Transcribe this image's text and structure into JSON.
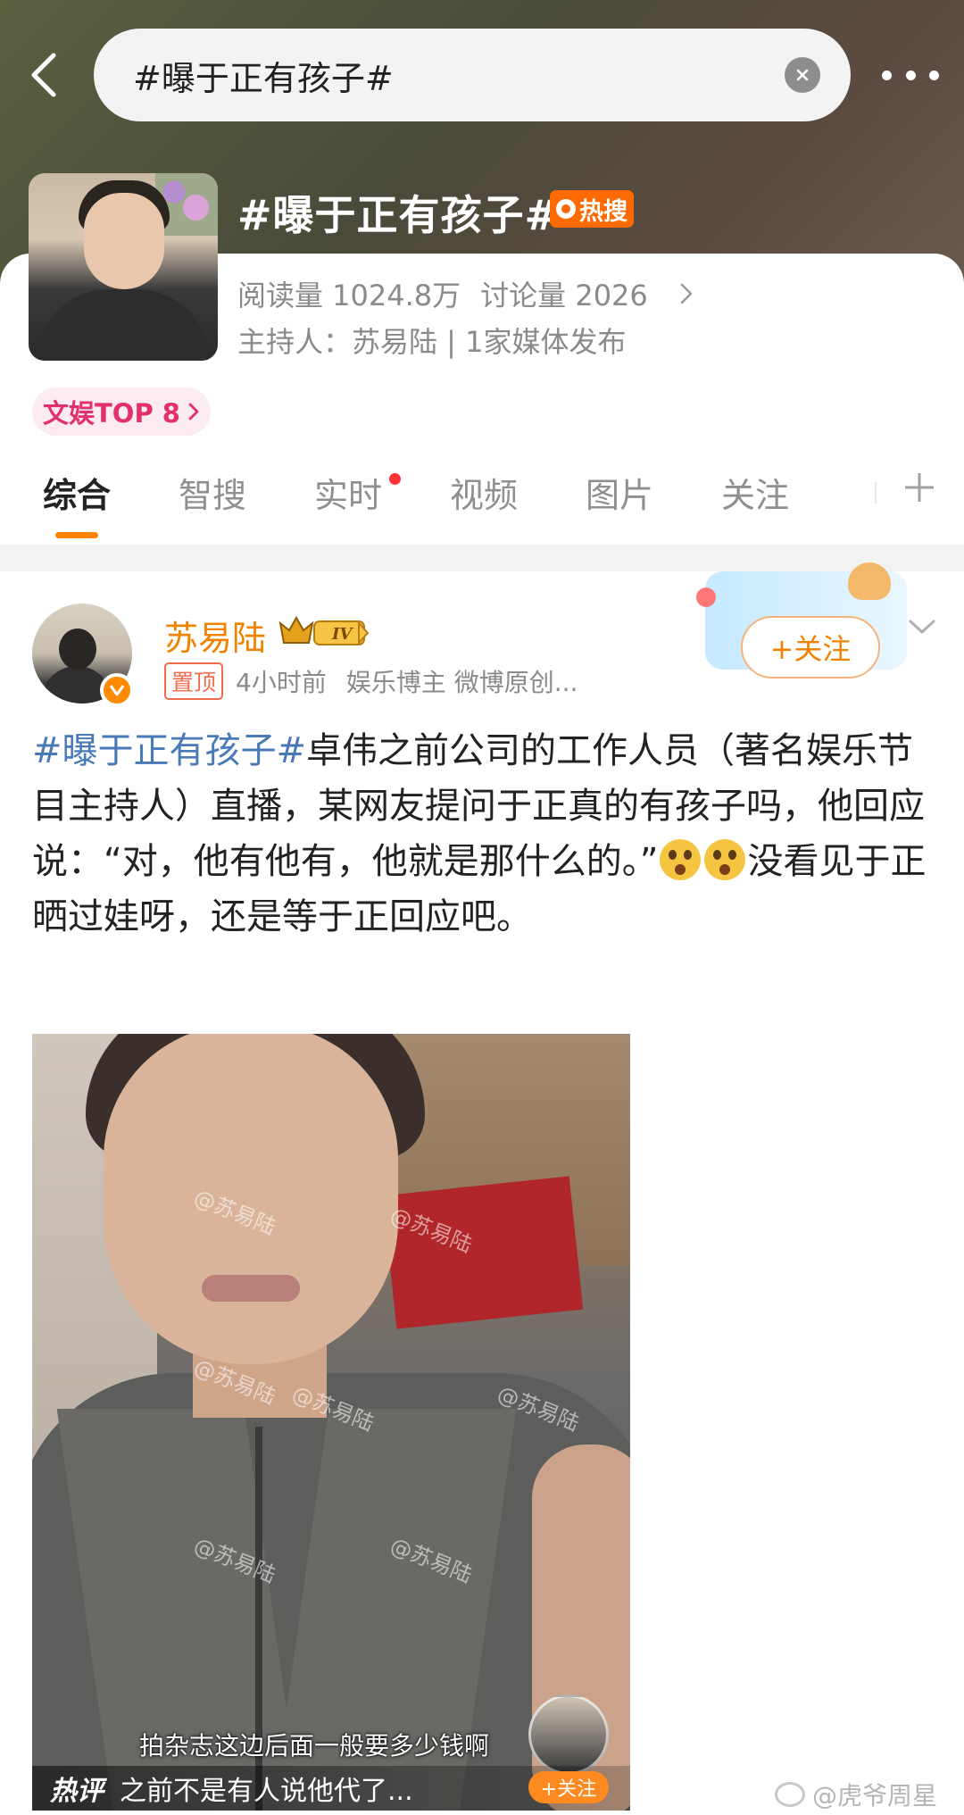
{
  "search": {
    "query": "#曝于正有孩子#"
  },
  "topic": {
    "title": "#曝于正有孩子#",
    "hot_badge": "热搜",
    "reads": "阅读量 1024.8万",
    "discussions": "讨论量 2026",
    "host": "主持人：苏易陆 | 1家媒体发布",
    "rank": "文娱TOP 8"
  },
  "tabs": [
    {
      "label": "综合"
    },
    {
      "label": "智搜"
    },
    {
      "label": "实时"
    },
    {
      "label": "视频"
    },
    {
      "label": "图片"
    },
    {
      "label": "关注"
    }
  ],
  "post": {
    "author": "苏易陆",
    "level": "IV",
    "pinned": "置顶",
    "time": "4小时前",
    "source": "娱乐博主 微博原创...",
    "follow": "+关注",
    "hashtag": "#曝于正有孩子#",
    "text_1": "卓伟之前公司的工作人员（著名娱乐节目主持人）直播，某网友提问于正真的有孩子吗，他回应说：“对，他有他有，他就是那什么的。”",
    "text_2": "没看见于正晒过娃呀，还是等于正回应吧。",
    "emoji": "flushed-face-icon"
  },
  "video": {
    "watermark": "@苏易陆",
    "subtitle": "拍杂志这边后面一般要多少钱啊",
    "hot_label": "热评",
    "hot_comment": "之前不是有人说他代了...",
    "mini_follow": "+关注"
  },
  "footer": {
    "watermark": "@虎爷周星"
  },
  "colors": {
    "accent": "#ff8200",
    "tag": "#4a79b8",
    "hot": "#ff6a00",
    "rank": "#e3306c"
  }
}
